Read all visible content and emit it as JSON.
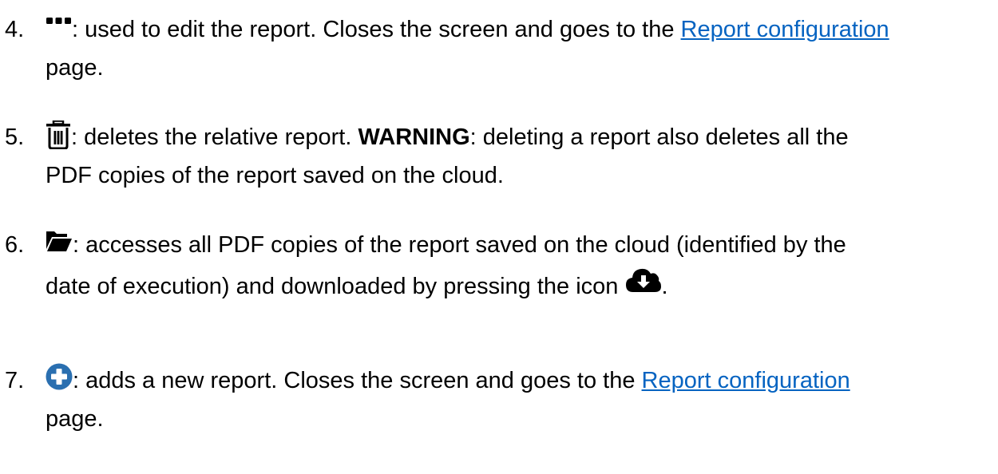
{
  "items": [
    {
      "number": "4.",
      "icon": "more-dots-icon",
      "text_before": ": used to edit the report. Closes the screen and goes to the ",
      "link": "Report configuration",
      "text_continued": "page."
    },
    {
      "number": "5.",
      "icon": "trash-icon",
      "text_before": ": deletes the relative report. ",
      "bold": "WARNING",
      "text_after": ": deleting a report also deletes all the",
      "text_continued": "PDF copies of the report saved on the cloud."
    },
    {
      "number": "6.",
      "icon": "folder-open-icon",
      "text_before": ": accesses all PDF copies of the report saved on the cloud (identified by the",
      "text_continued": "date of execution) and downloaded by pressing the icon",
      "inline_icon": "cloud-download-icon",
      "text_end": "."
    },
    {
      "number": "7.",
      "icon": "plus-circle-icon",
      "text_before": ": adds a new report. Closes the screen and goes to the ",
      "link": "Report configuration",
      "text_continued": "page."
    }
  ],
  "colors": {
    "text": "#000000",
    "link": "#0563c1",
    "plus_icon": "#2a6fb0"
  }
}
